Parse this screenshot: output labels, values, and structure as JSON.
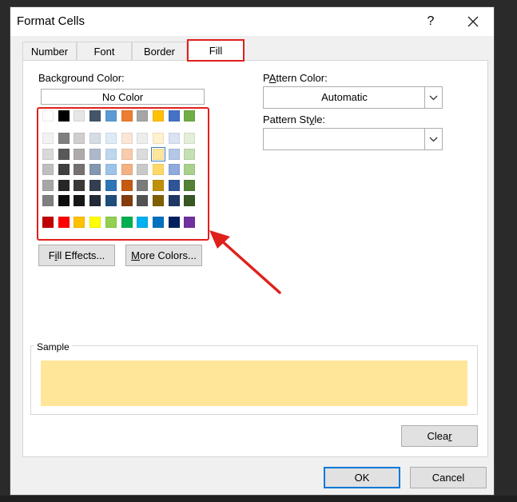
{
  "window": {
    "title": "Format Cells",
    "help": "?",
    "close": "×"
  },
  "tabs": [
    {
      "label": "Number",
      "active": false
    },
    {
      "label": "Font",
      "active": false
    },
    {
      "label": "Border",
      "active": false
    },
    {
      "label": "Fill",
      "active": true
    }
  ],
  "fill": {
    "background_color_label": "Background Color:",
    "no_color": "No Color",
    "theme_top_row": [
      "#ffffff",
      "#000000",
      "#e7e6e6",
      "#44546a",
      "#5b9bd5",
      "#ed7d31",
      "#a5a5a5",
      "#ffc000",
      "#4472c4",
      "#70ad47"
    ],
    "theme_shades": [
      [
        "#f2f2f2",
        "#7f7f7f",
        "#d0cece",
        "#d6dce4",
        "#deebf6",
        "#fbe5d6",
        "#ededed",
        "#fff2cc",
        "#dae3f3",
        "#e2f0d9"
      ],
      [
        "#d9d9d9",
        "#595959",
        "#aeaaaa",
        "#adb9ca",
        "#bdd7ee",
        "#f8cbad",
        "#dbdbdb",
        "#ffe699",
        "#b4c7e7",
        "#c5e0b4"
      ],
      [
        "#bfbfbf",
        "#404040",
        "#757171",
        "#8497b0",
        "#9dc3e6",
        "#f4b183",
        "#c9c9c9",
        "#ffd966",
        "#8faadc",
        "#a9d18e"
      ],
      [
        "#a6a6a6",
        "#262626",
        "#3b3838",
        "#333f50",
        "#2e75b6",
        "#c55a11",
        "#7b7b7b",
        "#bf9000",
        "#2f5597",
        "#538135"
      ],
      [
        "#7f7f7f",
        "#0d0d0d",
        "#171717",
        "#222a35",
        "#1f4e79",
        "#843c0c",
        "#525252",
        "#7f6000",
        "#1f3864",
        "#385723"
      ]
    ],
    "standard_colors": [
      "#c00000",
      "#ff0000",
      "#ffc000",
      "#ffff00",
      "#92d050",
      "#00b050",
      "#00b0f0",
      "#0070c0",
      "#002060",
      "#7030a0"
    ],
    "selected_color": "#ffe699",
    "fill_effects_prefix": "F",
    "fill_effects_underlined": "i",
    "fill_effects_suffix": "ll Effects...",
    "more_colors_prefix": "",
    "more_colors_underlined": "M",
    "more_colors_suffix": "ore Colors..."
  },
  "pattern": {
    "color_label_underlined": "A",
    "color_label_rest": "ttern Color:",
    "color_label_prefix": "P",
    "color_value": "Automatic",
    "style_label_prefix": "Pattern St",
    "style_label_underlined": "y",
    "style_label_rest": "le:",
    "style_value": ""
  },
  "sample": {
    "label": "Sample",
    "color": "#ffe699"
  },
  "buttons": {
    "clear_prefix": "Clea",
    "clear_underlined": "r",
    "ok": "OK",
    "cancel": "Cancel"
  },
  "annotation": {
    "color": "#e0201b"
  }
}
